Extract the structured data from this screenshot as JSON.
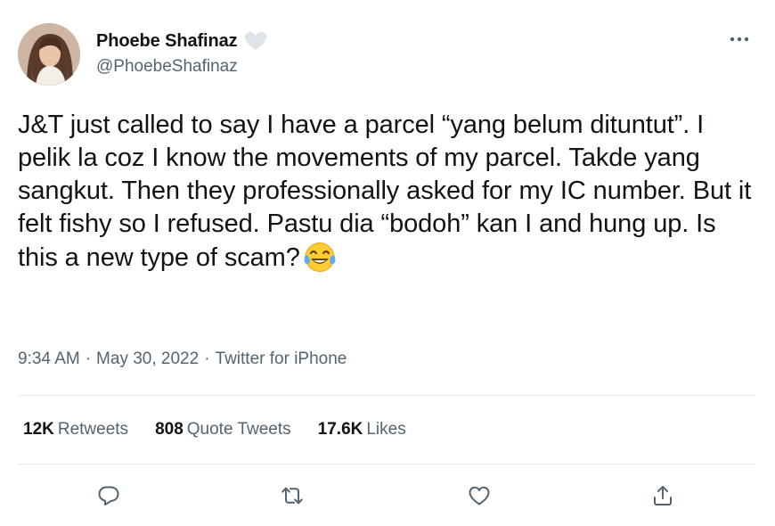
{
  "author": {
    "display_name": "Phoebe Shafinaz",
    "handle": "@PhoebeShafinaz",
    "badge_icon": "heart-icon"
  },
  "tweet": {
    "text": "J&T just called to say I have a parcel “yang belum dituntut”. I pelik la coz I know the movements of my parcel. Takde yang sangkut. Then they professionally asked for my IC number. But it felt fishy so I refused. Pastu dia “bodoh” kan I and hung up. Is this a new type of scam?",
    "emoji": "face-with-tears-of-joy",
    "time": "9:34 AM",
    "date": "May 30, 2022",
    "source": "Twitter for iPhone",
    "separator": "·"
  },
  "stats": {
    "retweets": {
      "count": "12K",
      "label": "Retweets"
    },
    "quotes": {
      "count": "808",
      "label": "Quote Tweets"
    },
    "likes": {
      "count": "17.6K",
      "label": "Likes"
    }
  },
  "actions": {
    "reply_icon": "reply-icon",
    "retweet_icon": "retweet-icon",
    "like_icon": "like-icon",
    "share_icon": "share-icon"
  },
  "colors": {
    "text_primary": "#0f1419",
    "text_secondary": "#536471",
    "divider": "#e6ecf0",
    "icon": "#536471"
  }
}
